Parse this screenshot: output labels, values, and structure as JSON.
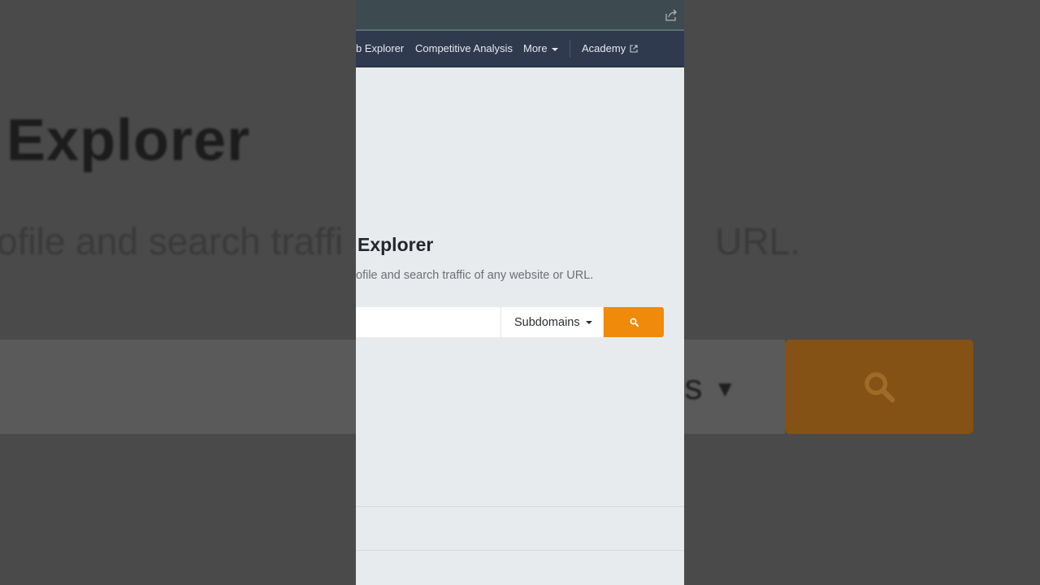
{
  "nav": {
    "items": [
      {
        "label": "b Explorer"
      },
      {
        "label": "Competitive Analysis"
      },
      {
        "label": "More"
      },
      {
        "label": "Academy"
      }
    ]
  },
  "hero": {
    "title": "Explorer",
    "subtitle": "ofile and search traffic of any website or URL."
  },
  "search": {
    "input_value": "",
    "mode_selected": "Subdomains"
  },
  "backdrop": {
    "title": "Explorer",
    "subtitle": "ofile and search traffi",
    "subtitle_tail": "URL.",
    "dropdown_fragment": "ns"
  },
  "colors": {
    "accent": "#f08a0a",
    "nav_bg": "#2f3a4e",
    "page_bg": "#e8ebed"
  }
}
